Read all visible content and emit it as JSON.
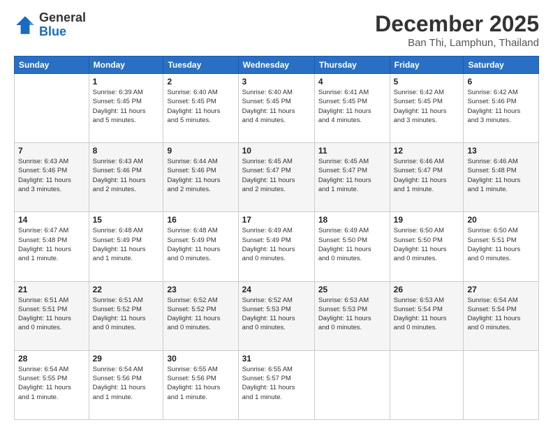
{
  "logo": {
    "general": "General",
    "blue": "Blue"
  },
  "title": "December 2025",
  "location": "Ban Thi, Lamphun, Thailand",
  "days_of_week": [
    "Sunday",
    "Monday",
    "Tuesday",
    "Wednesday",
    "Thursday",
    "Friday",
    "Saturday"
  ],
  "weeks": [
    [
      {
        "num": "",
        "info": ""
      },
      {
        "num": "1",
        "info": "Sunrise: 6:39 AM\nSunset: 5:45 PM\nDaylight: 11 hours\nand 5 minutes."
      },
      {
        "num": "2",
        "info": "Sunrise: 6:40 AM\nSunset: 5:45 PM\nDaylight: 11 hours\nand 5 minutes."
      },
      {
        "num": "3",
        "info": "Sunrise: 6:40 AM\nSunset: 5:45 PM\nDaylight: 11 hours\nand 4 minutes."
      },
      {
        "num": "4",
        "info": "Sunrise: 6:41 AM\nSunset: 5:45 PM\nDaylight: 11 hours\nand 4 minutes."
      },
      {
        "num": "5",
        "info": "Sunrise: 6:42 AM\nSunset: 5:45 PM\nDaylight: 11 hours\nand 3 minutes."
      },
      {
        "num": "6",
        "info": "Sunrise: 6:42 AM\nSunset: 5:46 PM\nDaylight: 11 hours\nand 3 minutes."
      }
    ],
    [
      {
        "num": "7",
        "info": "Sunrise: 6:43 AM\nSunset: 5:46 PM\nDaylight: 11 hours\nand 3 minutes."
      },
      {
        "num": "8",
        "info": "Sunrise: 6:43 AM\nSunset: 5:46 PM\nDaylight: 11 hours\nand 2 minutes."
      },
      {
        "num": "9",
        "info": "Sunrise: 6:44 AM\nSunset: 5:46 PM\nDaylight: 11 hours\nand 2 minutes."
      },
      {
        "num": "10",
        "info": "Sunrise: 6:45 AM\nSunset: 5:47 PM\nDaylight: 11 hours\nand 2 minutes."
      },
      {
        "num": "11",
        "info": "Sunrise: 6:45 AM\nSunset: 5:47 PM\nDaylight: 11 hours\nand 1 minute."
      },
      {
        "num": "12",
        "info": "Sunrise: 6:46 AM\nSunset: 5:47 PM\nDaylight: 11 hours\nand 1 minute."
      },
      {
        "num": "13",
        "info": "Sunrise: 6:46 AM\nSunset: 5:48 PM\nDaylight: 11 hours\nand 1 minute."
      }
    ],
    [
      {
        "num": "14",
        "info": "Sunrise: 6:47 AM\nSunset: 5:48 PM\nDaylight: 11 hours\nand 1 minute."
      },
      {
        "num": "15",
        "info": "Sunrise: 6:48 AM\nSunset: 5:49 PM\nDaylight: 11 hours\nand 1 minute."
      },
      {
        "num": "16",
        "info": "Sunrise: 6:48 AM\nSunset: 5:49 PM\nDaylight: 11 hours\nand 0 minutes."
      },
      {
        "num": "17",
        "info": "Sunrise: 6:49 AM\nSunset: 5:49 PM\nDaylight: 11 hours\nand 0 minutes."
      },
      {
        "num": "18",
        "info": "Sunrise: 6:49 AM\nSunset: 5:50 PM\nDaylight: 11 hours\nand 0 minutes."
      },
      {
        "num": "19",
        "info": "Sunrise: 6:50 AM\nSunset: 5:50 PM\nDaylight: 11 hours\nand 0 minutes."
      },
      {
        "num": "20",
        "info": "Sunrise: 6:50 AM\nSunset: 5:51 PM\nDaylight: 11 hours\nand 0 minutes."
      }
    ],
    [
      {
        "num": "21",
        "info": "Sunrise: 6:51 AM\nSunset: 5:51 PM\nDaylight: 11 hours\nand 0 minutes."
      },
      {
        "num": "22",
        "info": "Sunrise: 6:51 AM\nSunset: 5:52 PM\nDaylight: 11 hours\nand 0 minutes."
      },
      {
        "num": "23",
        "info": "Sunrise: 6:52 AM\nSunset: 5:52 PM\nDaylight: 11 hours\nand 0 minutes."
      },
      {
        "num": "24",
        "info": "Sunrise: 6:52 AM\nSunset: 5:53 PM\nDaylight: 11 hours\nand 0 minutes."
      },
      {
        "num": "25",
        "info": "Sunrise: 6:53 AM\nSunset: 5:53 PM\nDaylight: 11 hours\nand 0 minutes."
      },
      {
        "num": "26",
        "info": "Sunrise: 6:53 AM\nSunset: 5:54 PM\nDaylight: 11 hours\nand 0 minutes."
      },
      {
        "num": "27",
        "info": "Sunrise: 6:54 AM\nSunset: 5:54 PM\nDaylight: 11 hours\nand 0 minutes."
      }
    ],
    [
      {
        "num": "28",
        "info": "Sunrise: 6:54 AM\nSunset: 5:55 PM\nDaylight: 11 hours\nand 1 minute."
      },
      {
        "num": "29",
        "info": "Sunrise: 6:54 AM\nSunset: 5:56 PM\nDaylight: 11 hours\nand 1 minute."
      },
      {
        "num": "30",
        "info": "Sunrise: 6:55 AM\nSunset: 5:56 PM\nDaylight: 11 hours\nand 1 minute."
      },
      {
        "num": "31",
        "info": "Sunrise: 6:55 AM\nSunset: 5:57 PM\nDaylight: 11 hours\nand 1 minute."
      },
      {
        "num": "",
        "info": ""
      },
      {
        "num": "",
        "info": ""
      },
      {
        "num": "",
        "info": ""
      }
    ]
  ]
}
